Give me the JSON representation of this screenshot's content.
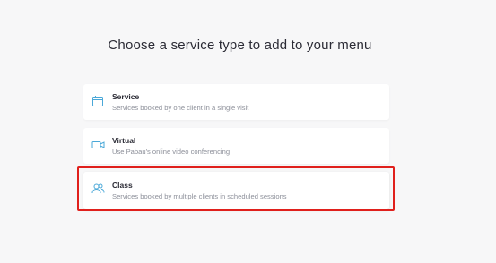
{
  "title": "Choose a service type to add to your menu",
  "accent_color": "#4aa8d8",
  "highlight_color": "#e0201c",
  "options": [
    {
      "name": "Service",
      "description": "Services booked by one client in a single visit",
      "icon": "calendar-icon"
    },
    {
      "name": "Virtual",
      "description": "Use Pabau's online video conferencing",
      "icon": "video-camera-icon"
    },
    {
      "name": "Class",
      "description": "Services booked by multiple clients in scheduled sessions",
      "icon": "group-icon"
    }
  ]
}
